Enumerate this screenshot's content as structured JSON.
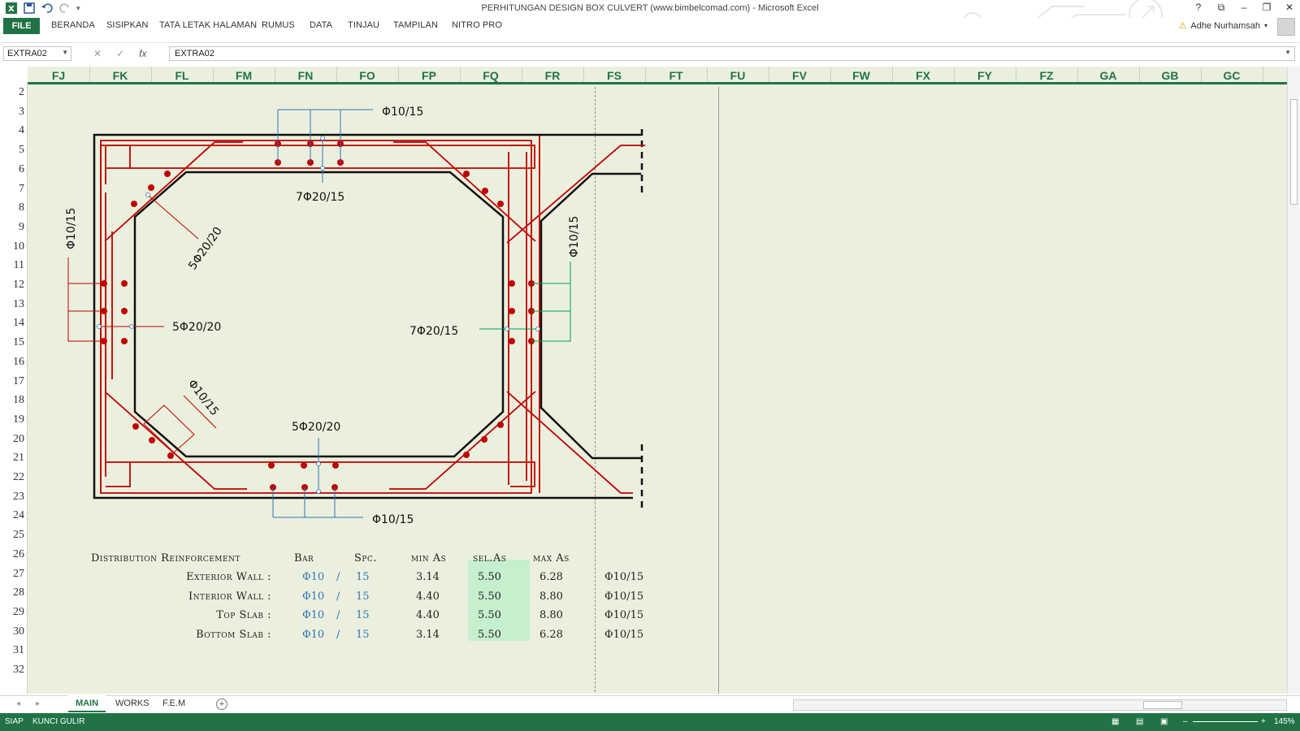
{
  "window": {
    "title": "PERHITUNGAN DESIGN BOX CULVERT (www.bimbelcomad.com) - Microsoft Excel",
    "controls": [
      "?",
      "⧉",
      "–",
      "❐",
      "✕"
    ]
  },
  "ribbon": {
    "file": "FILE",
    "tabs": [
      "BERANDA",
      "SISIPKAN",
      "TATA LETAK HALAMAN",
      "RUMUS",
      "DATA",
      "TINJAU",
      "TAMPILAN",
      "NITRO PRO"
    ],
    "user": "Adhe Nurhamsah"
  },
  "formula_bar": {
    "name_box": "EXTRA02",
    "formula": "EXTRA02",
    "fx": "fx"
  },
  "columns": [
    "FJ",
    "FK",
    "FL",
    "FM",
    "FN",
    "FO",
    "FP",
    "FQ",
    "FR",
    "FS",
    "FT",
    "FU",
    "FV",
    "FW",
    "FX",
    "FY",
    "FZ",
    "GA",
    "GB",
    "GC"
  ],
  "rows": [
    "2",
    "3",
    "4",
    "5",
    "6",
    "7",
    "8",
    "9",
    "10",
    "11",
    "12",
    "13",
    "14",
    "15",
    "16",
    "17",
    "18",
    "19",
    "20",
    "21",
    "22",
    "23",
    "24",
    "25",
    "26",
    "27",
    "28",
    "29",
    "30",
    "31",
    "32"
  ],
  "drawing": {
    "top_distribution": "Φ10/15",
    "top_main": "7Φ20/15",
    "left_haunch": "5Φ20/20",
    "left_wall_vertical": "Φ10/15",
    "left_wall_main": "5Φ20/20",
    "right_wall_main": "7Φ20/15",
    "right_wall_vertical": "Φ10/15",
    "bottom_haunch": "Φ10/15",
    "bottom_main": "5Φ20/20",
    "bottom_distribution": "Φ10/15"
  },
  "distribution": {
    "title": "Distribution Reinforcement",
    "headers": {
      "bar": "Bar",
      "spc": "Spc.",
      "min_as": "min As",
      "sel_as": "sel.As",
      "max_as": "max As"
    },
    "rows": [
      {
        "label": "Exterior Wall :",
        "bar": "Φ10",
        "slash": "/",
        "spc": "15",
        "min_as": "3.14",
        "sel_as": "5.50",
        "max_as": "6.28",
        "result": "Φ10/15"
      },
      {
        "label": "Interior Wall :",
        "bar": "Φ10",
        "slash": "/",
        "spc": "15",
        "min_as": "4.40",
        "sel_as": "5.50",
        "max_as": "8.80",
        "result": "Φ10/15"
      },
      {
        "label": "Top Slab :",
        "bar": "Φ10",
        "slash": "/",
        "spc": "15",
        "min_as": "4.40",
        "sel_as": "5.50",
        "max_as": "8.80",
        "result": "Φ10/15"
      },
      {
        "label": "Bottom Slab :",
        "bar": "Φ10",
        "slash": "/",
        "spc": "15",
        "min_as": "3.14",
        "sel_as": "5.50",
        "max_as": "6.28",
        "result": "Φ10/15"
      }
    ]
  },
  "sheets": {
    "active": "MAIN",
    "others": [
      "WORKS",
      "F.E.M"
    ]
  },
  "status": {
    "ready": "SIAP",
    "scroll_lock": "KUNCI GULIR",
    "zoom": "145%"
  },
  "colors": {
    "excel_green": "#217346",
    "rebar_red": "#c00000",
    "sheet_bg": "#ebf0de",
    "annot_blue": "#2e75b6",
    "annot_green": "#00a050"
  }
}
